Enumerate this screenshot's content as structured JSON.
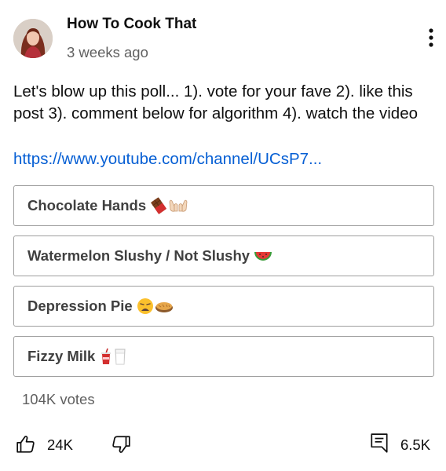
{
  "post": {
    "channel_name": "How To Cook That",
    "timestamp": "3 weeks ago",
    "text": "Let's blow up this poll... 1). vote for your fave  2). like this post  3). comment below for algorithm 4). watch the video",
    "link": "https://www.youtube.com/channel/UCsP7..."
  },
  "poll": {
    "options": [
      {
        "label": "Chocolate Hands",
        "emoji": [
          "chocolate-bar-icon",
          "open-hands-icon"
        ]
      },
      {
        "label": "Watermelon Slushy / Not Slushy",
        "emoji": [
          "watermelon-icon"
        ]
      },
      {
        "label": "Depression Pie",
        "emoji": [
          "weary-face-icon",
          "pie-icon"
        ]
      },
      {
        "label": "Fizzy Milk",
        "emoji": [
          "cup-with-straw-icon",
          "glass-of-milk-icon"
        ]
      }
    ],
    "votes": "104K votes"
  },
  "actions": {
    "likes": "24K",
    "comments": "6.5K"
  },
  "icons": [
    "avatar",
    "more-vert-icon",
    "thumb-up-icon",
    "thumb-down-icon",
    "comment-icon"
  ],
  "colors": {
    "link": "#065fd4",
    "secondary_text": "#606060",
    "option_border": "#9e9e9e"
  }
}
